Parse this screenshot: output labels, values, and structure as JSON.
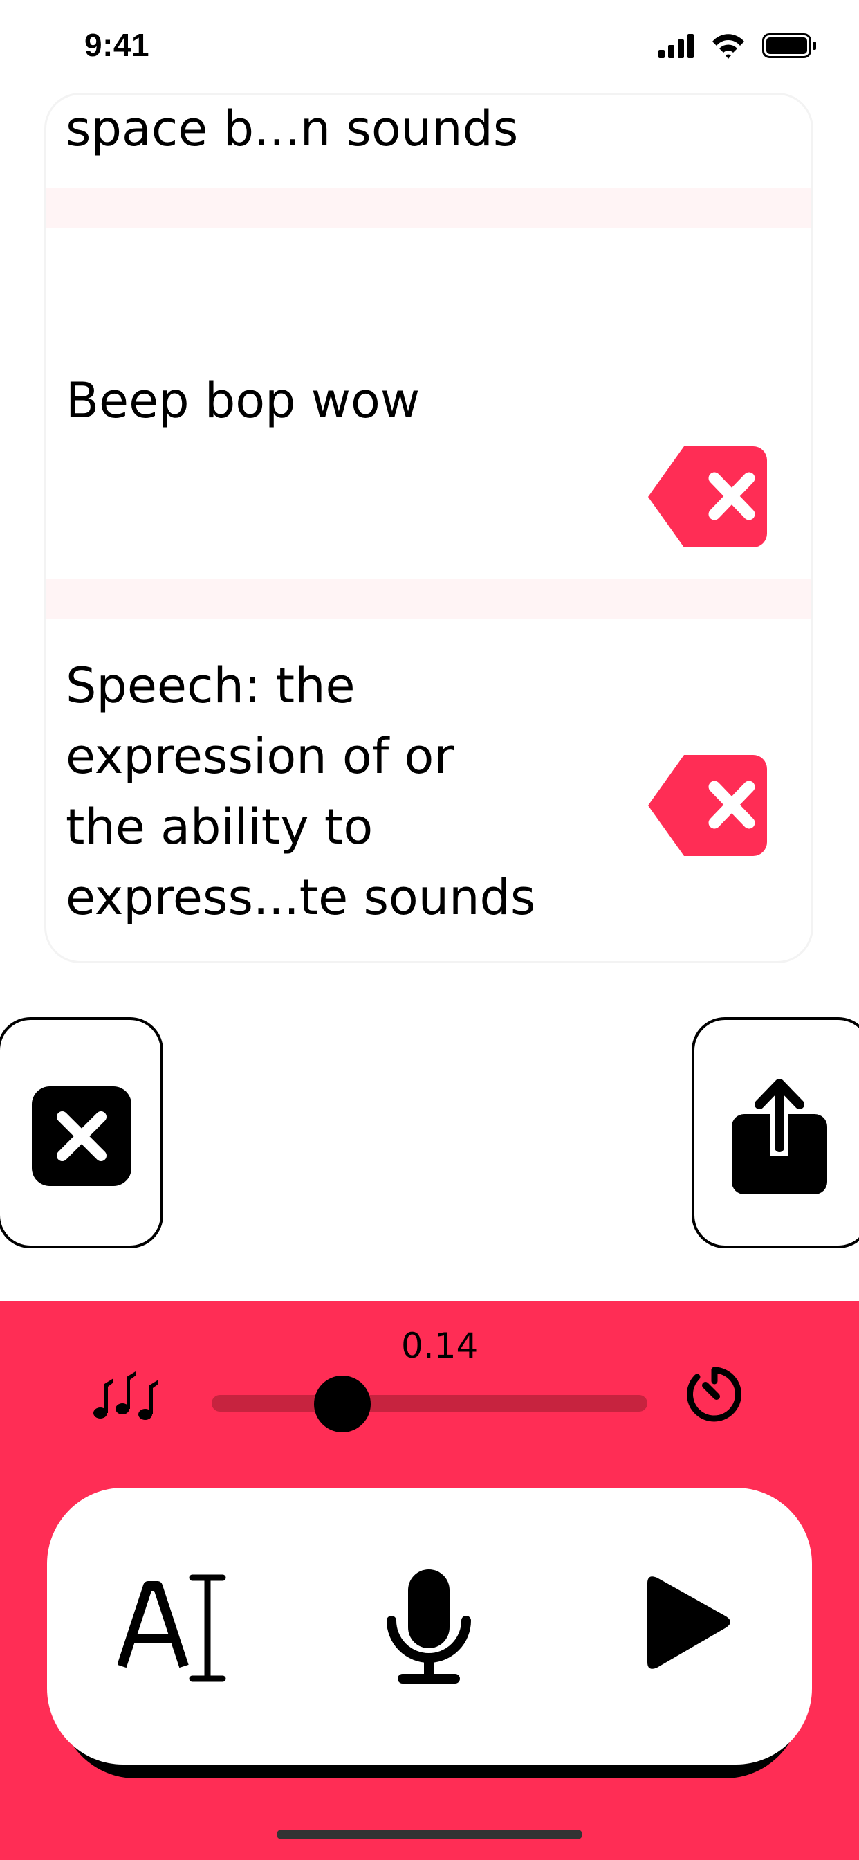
{
  "status_bar": {
    "time": "9:41"
  },
  "phrases": [
    {
      "text": "space b...n sounds"
    },
    {
      "text": "Beep bop wow"
    },
    {
      "text": "Speech: the\nexpression of or\nthe ability to\nexpress...te sounds"
    }
  ],
  "player": {
    "rate_value": "0.14",
    "rate_fraction": 0.3
  },
  "colors": {
    "accent": "#ff2d55",
    "separator": "#fff4f5",
    "track": "#c7233f"
  },
  "icons": {
    "delete": "delete-backspace-icon",
    "close": "close-square-icon",
    "share": "share-icon",
    "music": "music-notes-icon",
    "timer": "timer-icon",
    "text": "text-cursor-icon",
    "mic": "microphone-icon",
    "play": "play-icon"
  }
}
